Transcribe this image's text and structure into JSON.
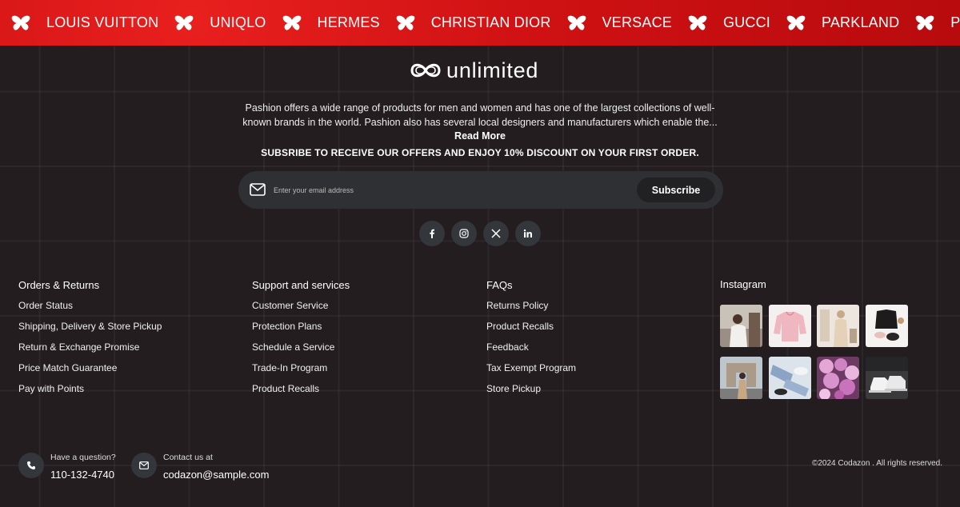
{
  "brand_bar": {
    "brands": [
      "LOUIS VUITTON",
      "UNIQLO",
      "HERMES",
      "CHRISTIAN DIOR",
      "VERSACE",
      "GUCCI",
      "PARKLAND",
      "PENCH"
    ],
    "separator_icon": "butterfly-icon",
    "background": "#d11214"
  },
  "logo": {
    "text": "unlimited",
    "icon": "infinity-logo-icon"
  },
  "about": {
    "text": "Pashion offers a wide range of products for men and women and has one of the largest collections of well-known brands in the world. Pashion also has several local designers and manufacturers which enable the...",
    "read_more": "Read More"
  },
  "subscribe": {
    "title": "SUBSRIBE TO RECEIVE OUR OFFERS AND ENJOY 10% DISCOUNT ON YOUR FIRST ORDER.",
    "placeholder": "Enter your email address",
    "button": "Subscribe",
    "icon": "envelope-icon"
  },
  "socials": [
    {
      "name": "facebook",
      "icon": "facebook-icon"
    },
    {
      "name": "instagram",
      "icon": "instagram-icon"
    },
    {
      "name": "x",
      "icon": "x-icon"
    },
    {
      "name": "linkedin",
      "icon": "linkedin-icon"
    }
  ],
  "columns": [
    {
      "title": "Orders & Returns",
      "links": [
        "Order Status",
        "Shipping, Delivery & Store Pickup",
        "Return & Exchange Promise",
        "Price Match Guarantee",
        "Pay with Points"
      ]
    },
    {
      "title": "Support and services",
      "links": [
        "Customer Service",
        "Protection Plans",
        "Schedule a Service",
        "Trade-In Program",
        "Product Recalls"
      ]
    },
    {
      "title": "FAQs",
      "links": [
        "Returns Policy",
        "Product Recalls",
        "Feedback",
        "Tax Exempt Program",
        "Store Pickup"
      ]
    }
  ],
  "instagram": {
    "title": "Instagram",
    "images": [
      {
        "subject": "woman-photo"
      },
      {
        "subject": "pink-sweater-photo"
      },
      {
        "subject": "beige-outfit-photo"
      },
      {
        "subject": "black-outfit-flatlay-photo"
      },
      {
        "subject": "arc-de-triomphe-photo"
      },
      {
        "subject": "jeans-sneakers-photo"
      },
      {
        "subject": "pink-flowers-photo"
      },
      {
        "subject": "white-sneakers-photo"
      }
    ]
  },
  "contact": {
    "phone_label": "Have a question?",
    "phone": "110-132-4740",
    "email_label": "Contact us at",
    "email": "codazon@sample.com"
  },
  "copyright": "©2024 Codazon . All rights reserved."
}
